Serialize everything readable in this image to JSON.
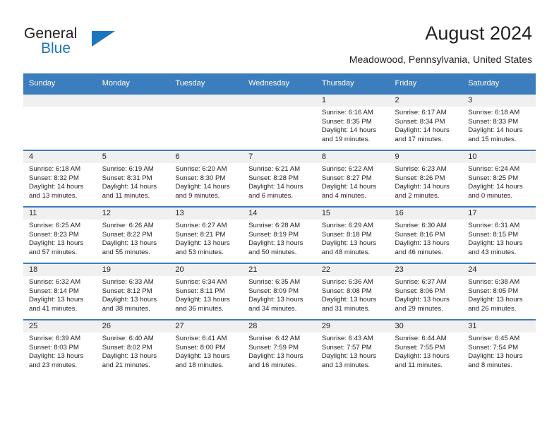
{
  "logo": {
    "text_top": "General",
    "text_bottom": "Blue",
    "triangle_color": "#1b76bc"
  },
  "header": {
    "title": "August 2024",
    "subtitle": "Meadowood, Pennsylvania, United States"
  },
  "theme": {
    "header_blue": "#3c7ebd",
    "daynum_band": "#f0f0f0",
    "text": "#231f20"
  },
  "weekday_headers": [
    "Sunday",
    "Monday",
    "Tuesday",
    "Wednesday",
    "Thursday",
    "Friday",
    "Saturday"
  ],
  "labels": {
    "sunrise": "Sunrise:",
    "sunset": "Sunset:",
    "daylight": "Daylight:"
  },
  "weeks": [
    [
      {
        "day": "",
        "empty": true
      },
      {
        "day": "",
        "empty": true
      },
      {
        "day": "",
        "empty": true
      },
      {
        "day": "",
        "empty": true
      },
      {
        "day": "1",
        "sunrise": "Sunrise: 6:16 AM",
        "sunset": "Sunset: 8:35 PM",
        "daylight1": "Daylight: 14 hours",
        "daylight2": "and 19 minutes."
      },
      {
        "day": "2",
        "sunrise": "Sunrise: 6:17 AM",
        "sunset": "Sunset: 8:34 PM",
        "daylight1": "Daylight: 14 hours",
        "daylight2": "and 17 minutes."
      },
      {
        "day": "3",
        "sunrise": "Sunrise: 6:18 AM",
        "sunset": "Sunset: 8:33 PM",
        "daylight1": "Daylight: 14 hours",
        "daylight2": "and 15 minutes."
      }
    ],
    [
      {
        "day": "4",
        "sunrise": "Sunrise: 6:18 AM",
        "sunset": "Sunset: 8:32 PM",
        "daylight1": "Daylight: 14 hours",
        "daylight2": "and 13 minutes."
      },
      {
        "day": "5",
        "sunrise": "Sunrise: 6:19 AM",
        "sunset": "Sunset: 8:31 PM",
        "daylight1": "Daylight: 14 hours",
        "daylight2": "and 11 minutes."
      },
      {
        "day": "6",
        "sunrise": "Sunrise: 6:20 AM",
        "sunset": "Sunset: 8:30 PM",
        "daylight1": "Daylight: 14 hours",
        "daylight2": "and 9 minutes."
      },
      {
        "day": "7",
        "sunrise": "Sunrise: 6:21 AM",
        "sunset": "Sunset: 8:28 PM",
        "daylight1": "Daylight: 14 hours",
        "daylight2": "and 6 minutes."
      },
      {
        "day": "8",
        "sunrise": "Sunrise: 6:22 AM",
        "sunset": "Sunset: 8:27 PM",
        "daylight1": "Daylight: 14 hours",
        "daylight2": "and 4 minutes."
      },
      {
        "day": "9",
        "sunrise": "Sunrise: 6:23 AM",
        "sunset": "Sunset: 8:26 PM",
        "daylight1": "Daylight: 14 hours",
        "daylight2": "and 2 minutes."
      },
      {
        "day": "10",
        "sunrise": "Sunrise: 6:24 AM",
        "sunset": "Sunset: 8:25 PM",
        "daylight1": "Daylight: 14 hours",
        "daylight2": "and 0 minutes."
      }
    ],
    [
      {
        "day": "11",
        "sunrise": "Sunrise: 6:25 AM",
        "sunset": "Sunset: 8:23 PM",
        "daylight1": "Daylight: 13 hours",
        "daylight2": "and 57 minutes."
      },
      {
        "day": "12",
        "sunrise": "Sunrise: 6:26 AM",
        "sunset": "Sunset: 8:22 PM",
        "daylight1": "Daylight: 13 hours",
        "daylight2": "and 55 minutes."
      },
      {
        "day": "13",
        "sunrise": "Sunrise: 6:27 AM",
        "sunset": "Sunset: 8:21 PM",
        "daylight1": "Daylight: 13 hours",
        "daylight2": "and 53 minutes."
      },
      {
        "day": "14",
        "sunrise": "Sunrise: 6:28 AM",
        "sunset": "Sunset: 8:19 PM",
        "daylight1": "Daylight: 13 hours",
        "daylight2": "and 50 minutes."
      },
      {
        "day": "15",
        "sunrise": "Sunrise: 6:29 AM",
        "sunset": "Sunset: 8:18 PM",
        "daylight1": "Daylight: 13 hours",
        "daylight2": "and 48 minutes."
      },
      {
        "day": "16",
        "sunrise": "Sunrise: 6:30 AM",
        "sunset": "Sunset: 8:16 PM",
        "daylight1": "Daylight: 13 hours",
        "daylight2": "and 46 minutes."
      },
      {
        "day": "17",
        "sunrise": "Sunrise: 6:31 AM",
        "sunset": "Sunset: 8:15 PM",
        "daylight1": "Daylight: 13 hours",
        "daylight2": "and 43 minutes."
      }
    ],
    [
      {
        "day": "18",
        "sunrise": "Sunrise: 6:32 AM",
        "sunset": "Sunset: 8:14 PM",
        "daylight1": "Daylight: 13 hours",
        "daylight2": "and 41 minutes."
      },
      {
        "day": "19",
        "sunrise": "Sunrise: 6:33 AM",
        "sunset": "Sunset: 8:12 PM",
        "daylight1": "Daylight: 13 hours",
        "daylight2": "and 38 minutes."
      },
      {
        "day": "20",
        "sunrise": "Sunrise: 6:34 AM",
        "sunset": "Sunset: 8:11 PM",
        "daylight1": "Daylight: 13 hours",
        "daylight2": "and 36 minutes."
      },
      {
        "day": "21",
        "sunrise": "Sunrise: 6:35 AM",
        "sunset": "Sunset: 8:09 PM",
        "daylight1": "Daylight: 13 hours",
        "daylight2": "and 34 minutes."
      },
      {
        "day": "22",
        "sunrise": "Sunrise: 6:36 AM",
        "sunset": "Sunset: 8:08 PM",
        "daylight1": "Daylight: 13 hours",
        "daylight2": "and 31 minutes."
      },
      {
        "day": "23",
        "sunrise": "Sunrise: 6:37 AM",
        "sunset": "Sunset: 8:06 PM",
        "daylight1": "Daylight: 13 hours",
        "daylight2": "and 29 minutes."
      },
      {
        "day": "24",
        "sunrise": "Sunrise: 6:38 AM",
        "sunset": "Sunset: 8:05 PM",
        "daylight1": "Daylight: 13 hours",
        "daylight2": "and 26 minutes."
      }
    ],
    [
      {
        "day": "25",
        "sunrise": "Sunrise: 6:39 AM",
        "sunset": "Sunset: 8:03 PM",
        "daylight1": "Daylight: 13 hours",
        "daylight2": "and 23 minutes."
      },
      {
        "day": "26",
        "sunrise": "Sunrise: 6:40 AM",
        "sunset": "Sunset: 8:02 PM",
        "daylight1": "Daylight: 13 hours",
        "daylight2": "and 21 minutes."
      },
      {
        "day": "27",
        "sunrise": "Sunrise: 6:41 AM",
        "sunset": "Sunset: 8:00 PM",
        "daylight1": "Daylight: 13 hours",
        "daylight2": "and 18 minutes."
      },
      {
        "day": "28",
        "sunrise": "Sunrise: 6:42 AM",
        "sunset": "Sunset: 7:59 PM",
        "daylight1": "Daylight: 13 hours",
        "daylight2": "and 16 minutes."
      },
      {
        "day": "29",
        "sunrise": "Sunrise: 6:43 AM",
        "sunset": "Sunset: 7:57 PM",
        "daylight1": "Daylight: 13 hours",
        "daylight2": "and 13 minutes."
      },
      {
        "day": "30",
        "sunrise": "Sunrise: 6:44 AM",
        "sunset": "Sunset: 7:55 PM",
        "daylight1": "Daylight: 13 hours",
        "daylight2": "and 11 minutes."
      },
      {
        "day": "31",
        "sunrise": "Sunrise: 6:45 AM",
        "sunset": "Sunset: 7:54 PM",
        "daylight1": "Daylight: 13 hours",
        "daylight2": "and 8 minutes."
      }
    ]
  ]
}
